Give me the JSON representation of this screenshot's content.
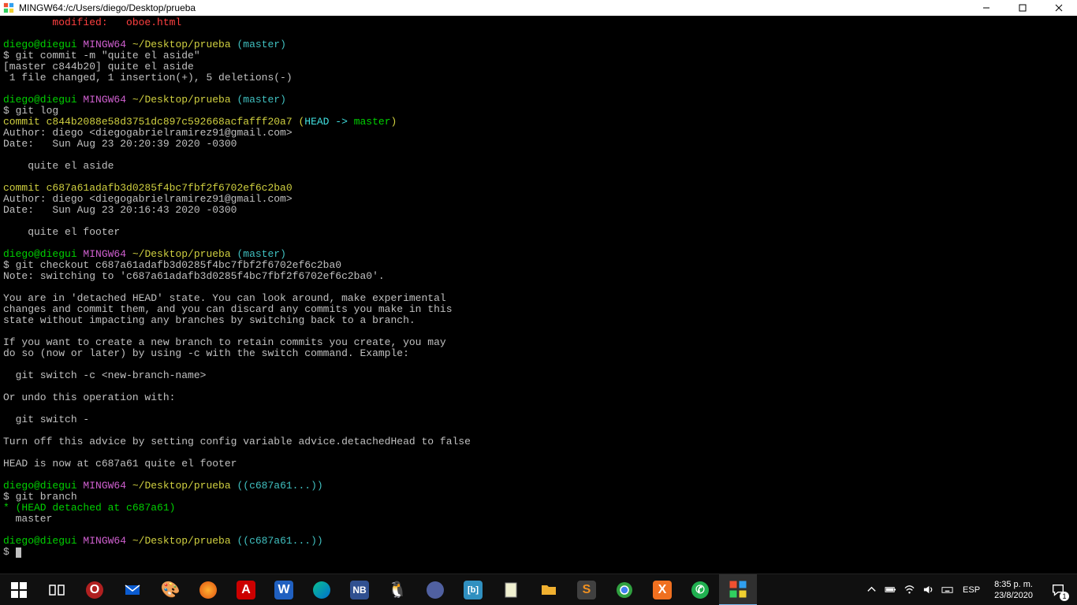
{
  "titlebar": {
    "title": "MINGW64:/c/Users/diego/Desktop/prueba"
  },
  "terminal": {
    "lines": [
      [
        {
          "cls": "red",
          "t": "        modified:   oboe.html"
        }
      ],
      [],
      [
        {
          "cls": "green",
          "t": "diego@diegui "
        },
        {
          "cls": "magenta",
          "t": "MINGW64 "
        },
        {
          "cls": "yellow",
          "t": "~/Desktop/prueba "
        },
        {
          "cls": "cyan",
          "t": "(master)"
        }
      ],
      [
        {
          "cls": "white",
          "t": "$ git commit -m \"quite el aside\""
        }
      ],
      [
        {
          "cls": "white",
          "t": "[master c844b20] quite el aside"
        }
      ],
      [
        {
          "cls": "white",
          "t": " 1 file changed, 1 insertion(+), 5 deletions(-)"
        }
      ],
      [],
      [
        {
          "cls": "green",
          "t": "diego@diegui "
        },
        {
          "cls": "magenta",
          "t": "MINGW64 "
        },
        {
          "cls": "yellow",
          "t": "~/Desktop/prueba "
        },
        {
          "cls": "cyan",
          "t": "(master)"
        }
      ],
      [
        {
          "cls": "white",
          "t": "$ git log"
        }
      ],
      [
        {
          "cls": "yellow",
          "t": "commit c844b2088e58d3751dc897c592668acfafff20a7 ("
        },
        {
          "cls": "brightcyan",
          "t": "HEAD -> "
        },
        {
          "cls": "green",
          "t": "master"
        },
        {
          "cls": "yellow",
          "t": ")"
        }
      ],
      [
        {
          "cls": "white",
          "t": "Author: diego <diegogabrielramirez91@gmail.com>"
        }
      ],
      [
        {
          "cls": "white",
          "t": "Date:   Sun Aug 23 20:20:39 2020 -0300"
        }
      ],
      [],
      [
        {
          "cls": "white",
          "t": "    quite el aside"
        }
      ],
      [],
      [
        {
          "cls": "yellow",
          "t": "commit c687a61adafb3d0285f4bc7fbf2f6702ef6c2ba0"
        }
      ],
      [
        {
          "cls": "white",
          "t": "Author: diego <diegogabrielramirez91@gmail.com>"
        }
      ],
      [
        {
          "cls": "white",
          "t": "Date:   Sun Aug 23 20:16:43 2020 -0300"
        }
      ],
      [],
      [
        {
          "cls": "white",
          "t": "    quite el footer"
        }
      ],
      [],
      [
        {
          "cls": "green",
          "t": "diego@diegui "
        },
        {
          "cls": "magenta",
          "t": "MINGW64 "
        },
        {
          "cls": "yellow",
          "t": "~/Desktop/prueba "
        },
        {
          "cls": "cyan",
          "t": "(master)"
        }
      ],
      [
        {
          "cls": "white",
          "t": "$ git checkout c687a61adafb3d0285f4bc7fbf2f6702ef6c2ba0"
        }
      ],
      [
        {
          "cls": "white",
          "t": "Note: switching to 'c687a61adafb3d0285f4bc7fbf2f6702ef6c2ba0'."
        }
      ],
      [],
      [
        {
          "cls": "white",
          "t": "You are in 'detached HEAD' state. You can look around, make experimental"
        }
      ],
      [
        {
          "cls": "white",
          "t": "changes and commit them, and you can discard any commits you make in this"
        }
      ],
      [
        {
          "cls": "white",
          "t": "state without impacting any branches by switching back to a branch."
        }
      ],
      [],
      [
        {
          "cls": "white",
          "t": "If you want to create a new branch to retain commits you create, you may"
        }
      ],
      [
        {
          "cls": "white",
          "t": "do so (now or later) by using -c with the switch command. Example:"
        }
      ],
      [],
      [
        {
          "cls": "white",
          "t": "  git switch -c <new-branch-name>"
        }
      ],
      [],
      [
        {
          "cls": "white",
          "t": "Or undo this operation with:"
        }
      ],
      [],
      [
        {
          "cls": "white",
          "t": "  git switch -"
        }
      ],
      [],
      [
        {
          "cls": "white",
          "t": "Turn off this advice by setting config variable advice.detachedHead to false"
        }
      ],
      [],
      [
        {
          "cls": "white",
          "t": "HEAD is now at c687a61 quite el footer"
        }
      ],
      [],
      [
        {
          "cls": "green",
          "t": "diego@diegui "
        },
        {
          "cls": "magenta",
          "t": "MINGW64 "
        },
        {
          "cls": "yellow",
          "t": "~/Desktop/prueba "
        },
        {
          "cls": "cyan",
          "t": "((c687a61...))"
        }
      ],
      [
        {
          "cls": "white",
          "t": "$ git branch"
        }
      ],
      [
        {
          "cls": "green",
          "t": "* (HEAD detached at c687a61)"
        }
      ],
      [
        {
          "cls": "white",
          "t": "  master"
        }
      ],
      [],
      [
        {
          "cls": "green",
          "t": "diego@diegui "
        },
        {
          "cls": "magenta",
          "t": "MINGW64 "
        },
        {
          "cls": "yellow",
          "t": "~/Desktop/prueba "
        },
        {
          "cls": "cyan",
          "t": "((c687a61...))"
        }
      ],
      [
        {
          "cls": "white",
          "t": "$ "
        },
        {
          "cursor": true
        }
      ]
    ]
  },
  "taskbar": {
    "lang": "ESP",
    "time": "8:35 p. m.",
    "date": "23/8/2020",
    "notif_count": "1"
  }
}
